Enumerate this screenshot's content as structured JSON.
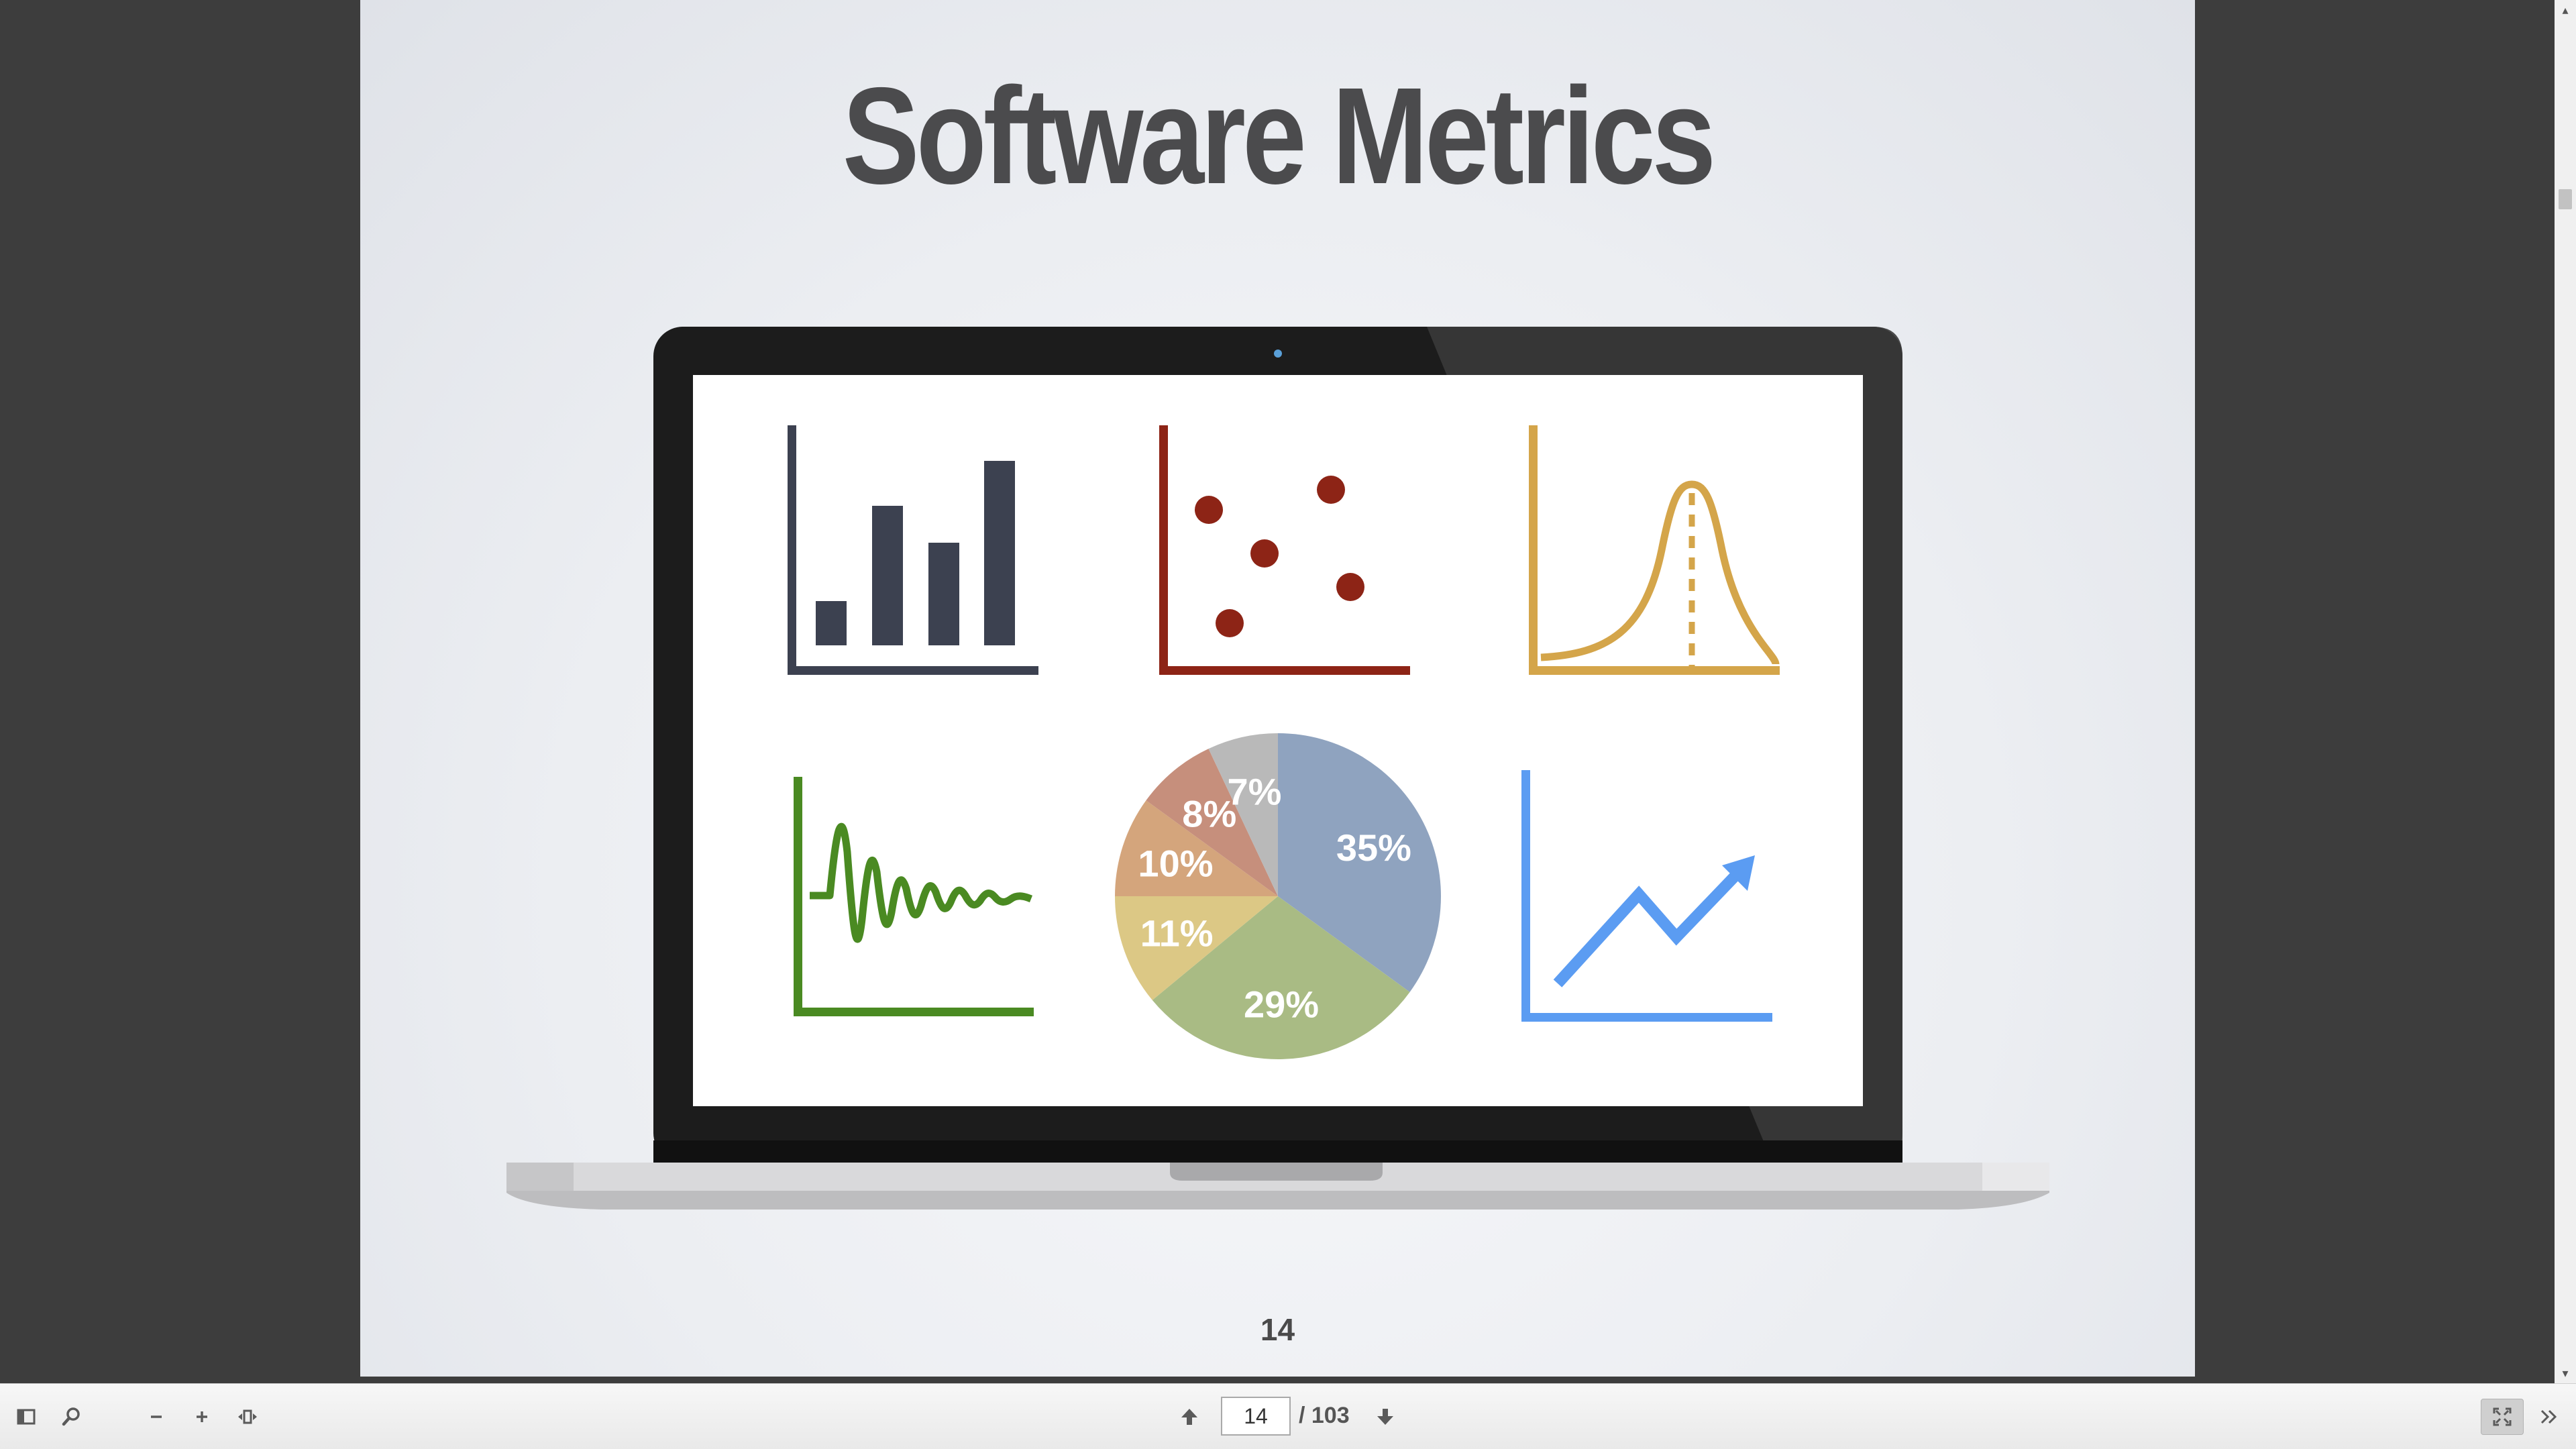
{
  "slide": {
    "title": "Software Metrics",
    "page_number": "14"
  },
  "pie": {
    "labels": [
      "35%",
      "29%",
      "11%",
      "10%",
      "8%",
      "7%"
    ],
    "colors": [
      "#8fa3bf",
      "#a9bb84",
      "#dcc885",
      "#d4a57c",
      "#c68f7c",
      "#b9b9b9"
    ]
  },
  "icons": {
    "bar_chart_color": "#3c4150",
    "scatter_color": "#8d2416",
    "bell_curve_color": "#d4a54a",
    "wave_color": "#4a8a22",
    "trend_color": "#5b9cf2"
  },
  "toolbar": {
    "current_page": "14",
    "total_pages": "/ 103",
    "sidebar_icon": "sidebar-toggle-icon",
    "search_icon": "search-icon",
    "zoom_out_icon": "minus-icon",
    "zoom_in_icon": "plus-icon",
    "fit_icon": "fit-width-icon",
    "prev_icon": "arrow-up-icon",
    "next_icon": "arrow-down-icon",
    "fullscreen_icon": "fullscreen-icon",
    "more_icon": "double-chevron-right-icon"
  }
}
